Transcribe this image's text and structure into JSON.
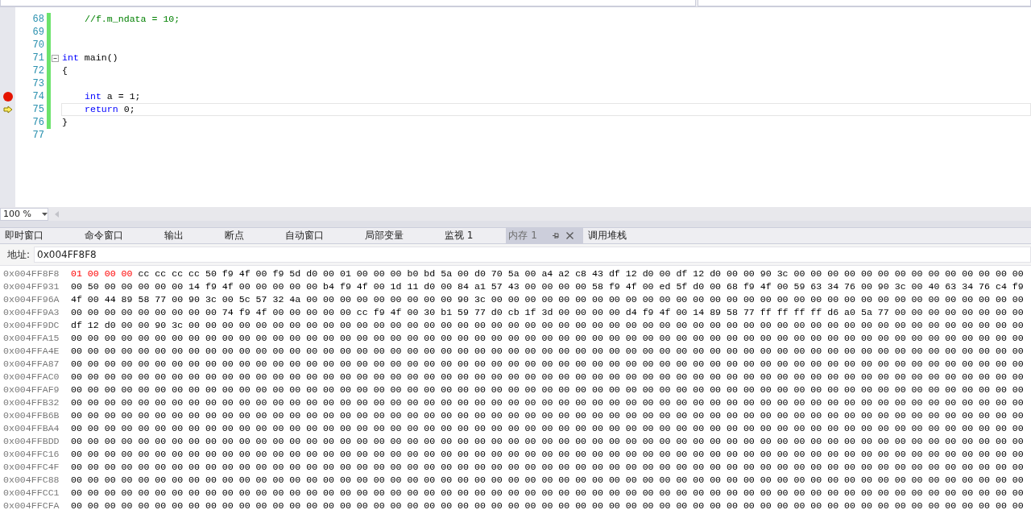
{
  "editor": {
    "lines": [
      {
        "number": "68",
        "modified": true,
        "indented": true,
        "collapsible": false,
        "breakpoint": false,
        "current": false,
        "tokens": [
          {
            "kind": "comment",
            "text": "//f.m_ndata = 10;"
          }
        ]
      },
      {
        "number": "69",
        "modified": true,
        "collapsible": false,
        "breakpoint": false,
        "current": false
      },
      {
        "number": "70",
        "modified": true,
        "collapsible": false,
        "breakpoint": false,
        "current": false
      },
      {
        "number": "71",
        "modified": true,
        "indented": false,
        "collapsible": true,
        "breakpoint": false,
        "current": false,
        "tokens": [
          {
            "kind": "keyword",
            "text": "int"
          },
          {
            "kind": "plain",
            "text": " main()"
          }
        ]
      },
      {
        "number": "72",
        "modified": true,
        "indented": false,
        "collapsible": false,
        "breakpoint": false,
        "current": false,
        "tokens": [
          {
            "kind": "plain",
            "text": "{"
          }
        ]
      },
      {
        "number": "73",
        "modified": true,
        "collapsible": false,
        "breakpoint": false,
        "current": false
      },
      {
        "number": "74",
        "modified": true,
        "indented": true,
        "collapsible": false,
        "breakpoint": true,
        "current": false,
        "tokens": [
          {
            "kind": "keyword",
            "text": "int"
          },
          {
            "kind": "plain",
            "text": " a = 1;"
          }
        ]
      },
      {
        "number": "75",
        "modified": true,
        "indented": true,
        "collapsible": false,
        "breakpoint": false,
        "current": true,
        "tokens": [
          {
            "kind": "keyword",
            "text": "return"
          },
          {
            "kind": "plain",
            "text": " 0;"
          }
        ]
      },
      {
        "number": "76",
        "modified": true,
        "indented": false,
        "collapsible": false,
        "breakpoint": false,
        "current": false,
        "tokens": [
          {
            "kind": "plain",
            "text": "}"
          }
        ]
      },
      {
        "number": "77",
        "modified": false,
        "collapsible": false,
        "breakpoint": false,
        "current": false
      }
    ]
  },
  "zoom": {
    "value": "100 %"
  },
  "tabs": [
    {
      "label": "即时窗口",
      "selected": false
    },
    {
      "label": "命令窗口",
      "selected": false
    },
    {
      "label": "输出",
      "selected": false
    },
    {
      "label": "断点",
      "selected": false
    },
    {
      "label": "自动窗口",
      "selected": false
    },
    {
      "label": "局部变量",
      "selected": false
    },
    {
      "label": "监视 1",
      "selected": false
    },
    {
      "label": "内存 1",
      "selected": true
    },
    {
      "label": "调用堆栈",
      "selected": false
    }
  ],
  "memory": {
    "address_label": "地址:",
    "address": "0x004FF8F8",
    "rows": [
      {
        "address": "0x004FF8F8",
        "segments": [
          {
            "text": "01 00 00 00",
            "changed": true
          },
          {
            "text": "cc cc cc cc 50 f9 4f 00 f9 5d d0 00 01 00 00 00 b0 bd 5a 00 d0 70 5a 00 a4 a2 c8 43 df 12 d0 00 df 12 d0 00 00 90 3c 00 00 00 00 00 00 00 00 00 00 00 00 00 00",
            "changed": false
          }
        ]
      },
      {
        "address": "0x004FF931",
        "segments": [
          {
            "text": "00 50 00 00 00 00 00 14 f9 4f 00 00 00 00 00 b4 f9 4f 00 1d 11 d0 00 84 a1 57 43 00 00 00 00 58 f9 4f 00 ed 5f d0 00 68 f9 4f 00 59 63 34 76 00 90 3c 00 40 63 34 76 c4 f9",
            "changed": false
          }
        ]
      },
      {
        "address": "0x004FF96A",
        "segments": [
          {
            "text": "4f 00 44 89 58 77 00 90 3c 00 5c 57 32 4a 00 00 00 00 00 00 00 00 00 90 3c 00 00 00 00 00 00 00 00 00 00 00 00 00 00 00 00 00 00 00 00 00 00 00 00 00 00 00 00 00 00 00 00",
            "changed": false
          }
        ]
      },
      {
        "address": "0x004FF9A3",
        "segments": [
          {
            "text": "00 00 00 00 00 00 00 00 00 74 f9 4f 00 00 00 00 00 cc f9 4f 00 30 b1 59 77 d0 cb 1f 3d 00 00 00 00 d4 f9 4f 00 14 89 58 77 ff ff ff ff d6 a0 5a 77 00 00 00 00 00 00 00 00",
            "changed": false
          }
        ]
      },
      {
        "address": "0x004FF9DC",
        "segments": [
          {
            "text": "df 12 d0 00 00 90 3c 00 00 00 00 00 00 00 00 00 00 00 00 00 00 00 00 00 00 00 00 00 00 00 00 00 00 00 00 00 00 00 00 00 00 00 00 00 00 00 00 00 00 00 00 00 00 00 00 00 00",
            "changed": false
          }
        ]
      },
      {
        "address": "0x004FFA15",
        "segments": [
          {
            "text": "00 00 00 00 00 00 00 00 00 00 00 00 00 00 00 00 00 00 00 00 00 00 00 00 00 00 00 00 00 00 00 00 00 00 00 00 00 00 00 00 00 00 00 00 00 00 00 00 00 00 00 00 00 00 00 00 00",
            "changed": false
          }
        ]
      },
      {
        "address": "0x004FFA4E",
        "segments": [
          {
            "text": "00 00 00 00 00 00 00 00 00 00 00 00 00 00 00 00 00 00 00 00 00 00 00 00 00 00 00 00 00 00 00 00 00 00 00 00 00 00 00 00 00 00 00 00 00 00 00 00 00 00 00 00 00 00 00 00 00",
            "changed": false
          }
        ]
      },
      {
        "address": "0x004FFA87",
        "segments": [
          {
            "text": "00 00 00 00 00 00 00 00 00 00 00 00 00 00 00 00 00 00 00 00 00 00 00 00 00 00 00 00 00 00 00 00 00 00 00 00 00 00 00 00 00 00 00 00 00 00 00 00 00 00 00 00 00 00 00 00 00",
            "changed": false
          }
        ]
      },
      {
        "address": "0x004FFAC0",
        "segments": [
          {
            "text": "00 00 00 00 00 00 00 00 00 00 00 00 00 00 00 00 00 00 00 00 00 00 00 00 00 00 00 00 00 00 00 00 00 00 00 00 00 00 00 00 00 00 00 00 00 00 00 00 00 00 00 00 00 00 00 00 00",
            "changed": false
          }
        ]
      },
      {
        "address": "0x004FFAF9",
        "segments": [
          {
            "text": "00 00 00 00 00 00 00 00 00 00 00 00 00 00 00 00 00 00 00 00 00 00 00 00 00 00 00 00 00 00 00 00 00 00 00 00 00 00 00 00 00 00 00 00 00 00 00 00 00 00 00 00 00 00 00 00 00",
            "changed": false
          }
        ]
      },
      {
        "address": "0x004FFB32",
        "segments": [
          {
            "text": "00 00 00 00 00 00 00 00 00 00 00 00 00 00 00 00 00 00 00 00 00 00 00 00 00 00 00 00 00 00 00 00 00 00 00 00 00 00 00 00 00 00 00 00 00 00 00 00 00 00 00 00 00 00 00 00 00",
            "changed": false
          }
        ]
      },
      {
        "address": "0x004FFB6B",
        "segments": [
          {
            "text": "00 00 00 00 00 00 00 00 00 00 00 00 00 00 00 00 00 00 00 00 00 00 00 00 00 00 00 00 00 00 00 00 00 00 00 00 00 00 00 00 00 00 00 00 00 00 00 00 00 00 00 00 00 00 00 00 00",
            "changed": false
          }
        ]
      },
      {
        "address": "0x004FFBA4",
        "segments": [
          {
            "text": "00 00 00 00 00 00 00 00 00 00 00 00 00 00 00 00 00 00 00 00 00 00 00 00 00 00 00 00 00 00 00 00 00 00 00 00 00 00 00 00 00 00 00 00 00 00 00 00 00 00 00 00 00 00 00 00 00",
            "changed": false
          }
        ]
      },
      {
        "address": "0x004FFBDD",
        "segments": [
          {
            "text": "00 00 00 00 00 00 00 00 00 00 00 00 00 00 00 00 00 00 00 00 00 00 00 00 00 00 00 00 00 00 00 00 00 00 00 00 00 00 00 00 00 00 00 00 00 00 00 00 00 00 00 00 00 00 00 00 00",
            "changed": false
          }
        ]
      },
      {
        "address": "0x004FFC16",
        "segments": [
          {
            "text": "00 00 00 00 00 00 00 00 00 00 00 00 00 00 00 00 00 00 00 00 00 00 00 00 00 00 00 00 00 00 00 00 00 00 00 00 00 00 00 00 00 00 00 00 00 00 00 00 00 00 00 00 00 00 00 00 00",
            "changed": false
          }
        ]
      },
      {
        "address": "0x004FFC4F",
        "segments": [
          {
            "text": "00 00 00 00 00 00 00 00 00 00 00 00 00 00 00 00 00 00 00 00 00 00 00 00 00 00 00 00 00 00 00 00 00 00 00 00 00 00 00 00 00 00 00 00 00 00 00 00 00 00 00 00 00 00 00 00 00",
            "changed": false
          }
        ]
      },
      {
        "address": "0x004FFC88",
        "segments": [
          {
            "text": "00 00 00 00 00 00 00 00 00 00 00 00 00 00 00 00 00 00 00 00 00 00 00 00 00 00 00 00 00 00 00 00 00 00 00 00 00 00 00 00 00 00 00 00 00 00 00 00 00 00 00 00 00 00 00 00 00",
            "changed": false
          }
        ]
      },
      {
        "address": "0x004FFCC1",
        "segments": [
          {
            "text": "00 00 00 00 00 00 00 00 00 00 00 00 00 00 00 00 00 00 00 00 00 00 00 00 00 00 00 00 00 00 00 00 00 00 00 00 00 00 00 00 00 00 00 00 00 00 00 00 00 00 00 00 00 00 00 00 00",
            "changed": false
          }
        ]
      },
      {
        "address": "0x004FFCFA",
        "segments": [
          {
            "text": "00 00 00 00 00 00 00 00 00 00 00 00 00 00 00 00 00 00 00 00 00 00 00 00 00 00 00 00 00 00 00 00 00 00 00 00 00 00 00 00 00 00 00 00 00 00 00 00 00 00 00 00 00 00 00 00 00",
            "changed": false
          }
        ]
      }
    ]
  }
}
